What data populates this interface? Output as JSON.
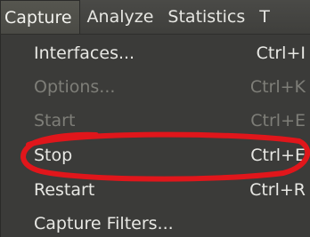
{
  "menubar": {
    "items": [
      {
        "label": "Capture",
        "active": true
      },
      {
        "label": "Analyze",
        "active": false
      },
      {
        "label": "Statistics",
        "active": false
      },
      {
        "label": "T",
        "active": false
      }
    ]
  },
  "capture_menu": {
    "items": [
      {
        "label": "Interfaces...",
        "shortcut": "Ctrl+I",
        "enabled": true
      },
      {
        "label": "Options...",
        "shortcut": "Ctrl+K",
        "enabled": false
      },
      {
        "label": "Start",
        "shortcut": "Ctrl+E",
        "enabled": false
      },
      {
        "label": "Stop",
        "shortcut": "Ctrl+E",
        "enabled": true,
        "circled": true
      },
      {
        "label": "Restart",
        "shortcut": "Ctrl+R",
        "enabled": true
      },
      {
        "label": "Capture Filters...",
        "shortcut": "",
        "enabled": true
      }
    ]
  },
  "annotation": {
    "color": "#e0161b"
  }
}
